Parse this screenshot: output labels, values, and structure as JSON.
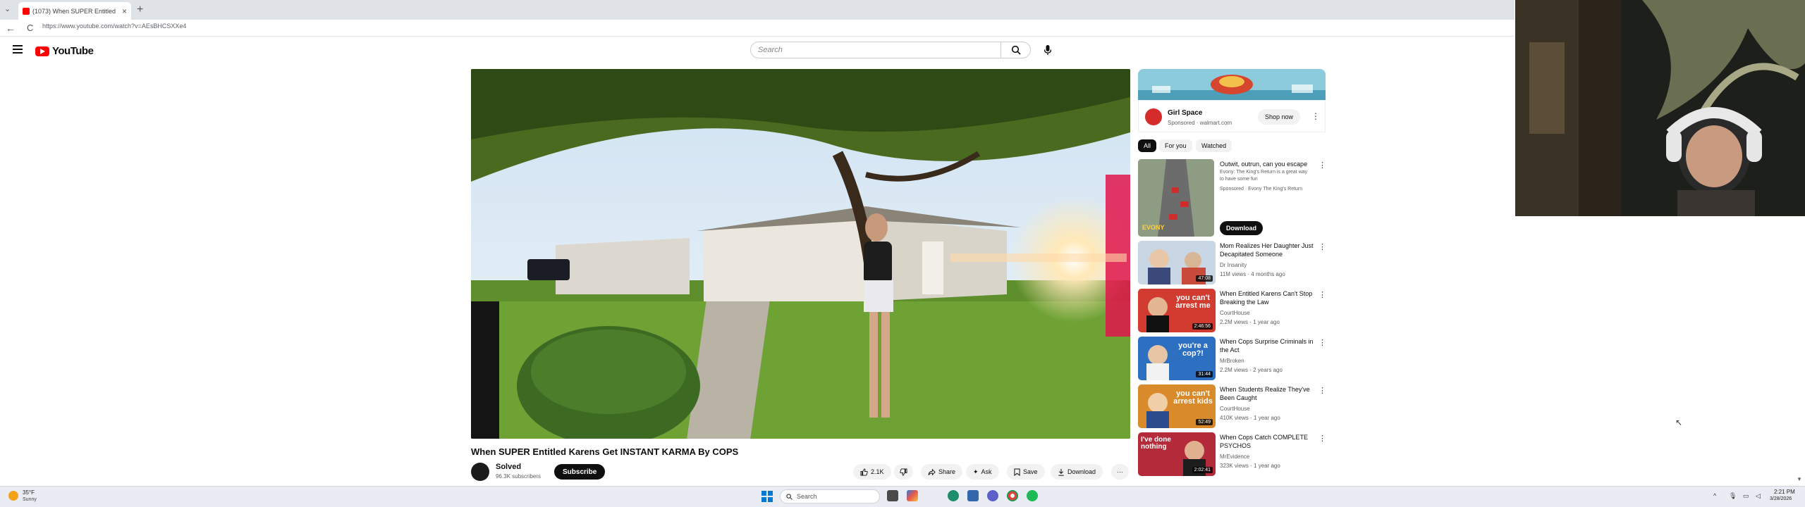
{
  "browser": {
    "tab_title": "(1073) When SUPER Entitled",
    "tab_close": "×",
    "new_tab": "+",
    "tab_search": "⌄",
    "url": "https://www.youtube.com/watch?v=AEsBHCSXXe4",
    "back": "←",
    "reload": "C"
  },
  "header": {
    "logo_text": "YouTube",
    "search_placeholder": "Search"
  },
  "video": {
    "title": "When SUPER Entitled Karens Get INSTANT KARMA By COPS",
    "channel": "Solved",
    "subscribers": "96.3K subscribers",
    "subscribe_label": "Subscribe",
    "likes": "2.1K",
    "share_label": "Share",
    "ask_label": "Ask",
    "save_label": "Save",
    "download_label": "Download",
    "more_label": "···"
  },
  "ad": {
    "name": "Girl Space",
    "sponsored": "Sponsored · walmart.com",
    "shop_label": "Shop now",
    "more": "⋮"
  },
  "chips": [
    "All",
    "For you",
    "Watched"
  ],
  "recommendations": [
    {
      "title": "Outwit, outrun, can you escape",
      "channel": "Evony: The King's Return is a great way to have some fun",
      "meta": "Sponsored · Evony The King's Return",
      "duration": "",
      "button": "Download",
      "thumb_text": "EVONY"
    },
    {
      "title": "Mom Realizes Her Daughter Just Decapitated Someone",
      "channel": "Dr Insanity",
      "meta": "11M views · 4 months ago",
      "duration": "47:08",
      "thumb_text": ""
    },
    {
      "title": "When Entitled Karens Can't Stop Breaking the Law",
      "channel": "CourtHouse",
      "meta": "2.2M views · 1 year ago",
      "duration": "2:46:56",
      "thumb_text": "you can't arrest me"
    },
    {
      "title": "When Cops Surprise Criminals in the Act",
      "channel": "MrBroken",
      "meta": "2.2M views · 2 years ago",
      "duration": "31:44",
      "thumb_text": "you're a cop?!"
    },
    {
      "title": "When Students Realize They've Been Caught",
      "channel": "CourtHouse",
      "meta": "410K views · 1 year ago",
      "duration": "52:49",
      "thumb_text": "you can't arrest kids"
    },
    {
      "title": "When Cops Catch COMPLETE PSYCHOS",
      "channel": "MrEvidence",
      "meta": "323K views · 1 year ago",
      "duration": "2:02:41",
      "thumb_text": "I've done nothing"
    }
  ],
  "taskbar": {
    "weather_temp": "35°F",
    "weather_cond": "Sunny",
    "search_label": "Search",
    "time": "2:21 PM",
    "date": "3/28/2026"
  },
  "colors": {
    "youtube_red": "#ff0000",
    "subscribe_bg": "#0f0f0f",
    "chip_bg": "#f2f2f2",
    "taskbar_bg": "#e9edf3"
  }
}
